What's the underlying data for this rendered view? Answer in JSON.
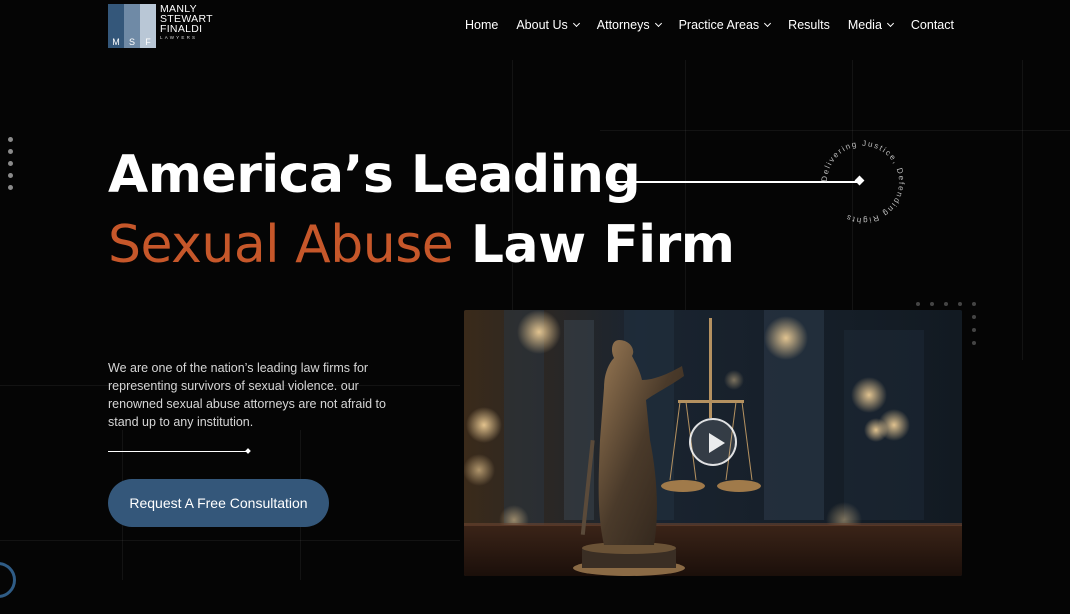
{
  "logo": {
    "letters": [
      "M",
      "S",
      "F"
    ],
    "line1": "MANLY",
    "line2": "STEWART",
    "line3": "FINALDI",
    "tagline": "LAWYERS"
  },
  "nav": {
    "items": [
      {
        "label": "Home",
        "dropdown": false
      },
      {
        "label": "About Us",
        "dropdown": true
      },
      {
        "label": "Attorneys",
        "dropdown": true
      },
      {
        "label": "Practice Areas",
        "dropdown": true
      },
      {
        "label": "Results",
        "dropdown": false
      },
      {
        "label": "Media",
        "dropdown": true
      },
      {
        "label": "Contact",
        "dropdown": false
      }
    ]
  },
  "hero": {
    "heading_line1": "America’s Leading",
    "heading_accent": "Sexual Abuse",
    "heading_rest": "Law Firm",
    "badge_text": "Delivering Justice, Defending Rights ",
    "paragraph": "We are one of the nation’s leading law firms for representing survivors of sexual violence. our renowned sexual abuse attorneys are not afraid to stand up to any institution.",
    "cta_label": "Request A Free Consultation"
  },
  "colors": {
    "background": "#050505",
    "accent_orange": "#c6572a",
    "button_blue": "#34577a",
    "logo_bars": [
      "#34577a",
      "#6f8aa6",
      "#b9c7d6"
    ]
  },
  "icons": {
    "play": "play-icon",
    "chevron": "chevron-down-icon"
  }
}
